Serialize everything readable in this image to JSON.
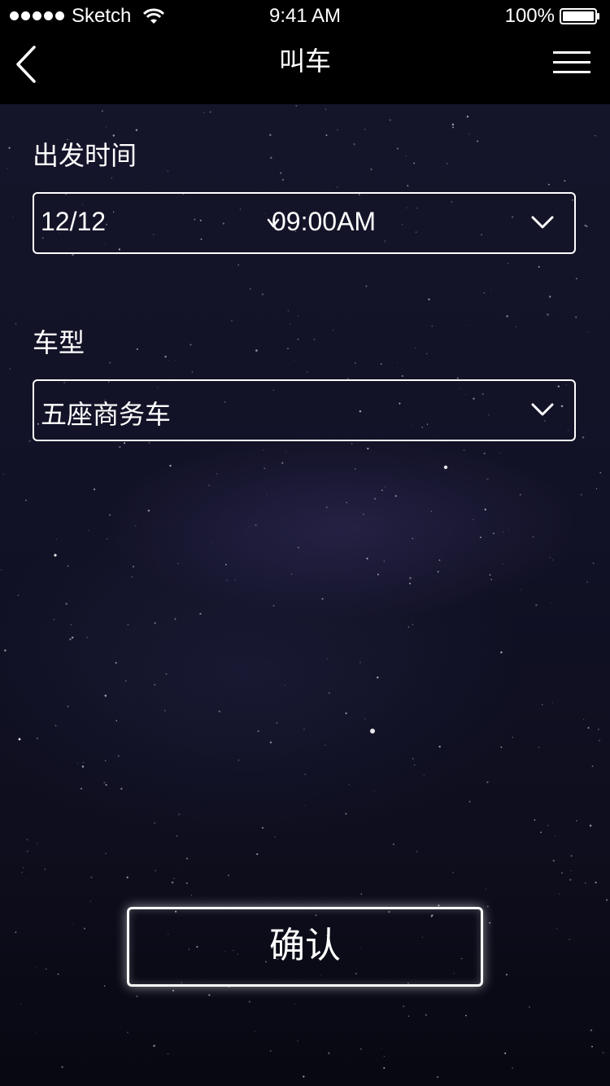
{
  "status_bar": {
    "carrier": "Sketch",
    "time": "9:41 AM",
    "battery_percent": "100%",
    "battery_level": 1.0
  },
  "nav": {
    "title": "叫车",
    "back_icon": "chevron-left-icon",
    "menu_icon": "hamburger-menu-icon"
  },
  "form": {
    "departure_label": "出发时间",
    "departure_date": "12/12",
    "departure_time": "09:00AM",
    "car_type_label": "车型",
    "car_type_value": "五座商务车"
  },
  "confirm_label": "确认",
  "colors": {
    "bar_background": "#000000",
    "text": "#ffffff",
    "border": "#ffffff"
  }
}
